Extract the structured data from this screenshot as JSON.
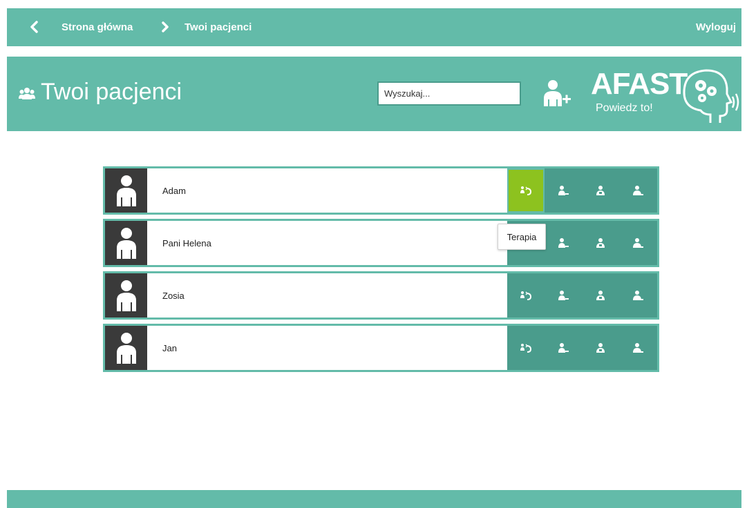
{
  "nav": {
    "breadcrumb": [
      "Strona główna",
      "Twoi pacjenci"
    ],
    "logout_label": "Wyloguj"
  },
  "header": {
    "title": "Twoi pacjenci",
    "search_placeholder": "Wyszukaj...",
    "logo_text": "AFAST",
    "logo_tagline": "Powiedz to!"
  },
  "patients": [
    {
      "name": "Adam"
    },
    {
      "name": "Pani Helena"
    },
    {
      "name": "Zosia"
    },
    {
      "name": "Jan"
    }
  ],
  "tooltip": "Terapia",
  "colors": {
    "primary": "#63bba9",
    "row_dark": "#4a9c8c",
    "active": "#8dc21f",
    "avatar_bg": "#3a3a3a"
  }
}
